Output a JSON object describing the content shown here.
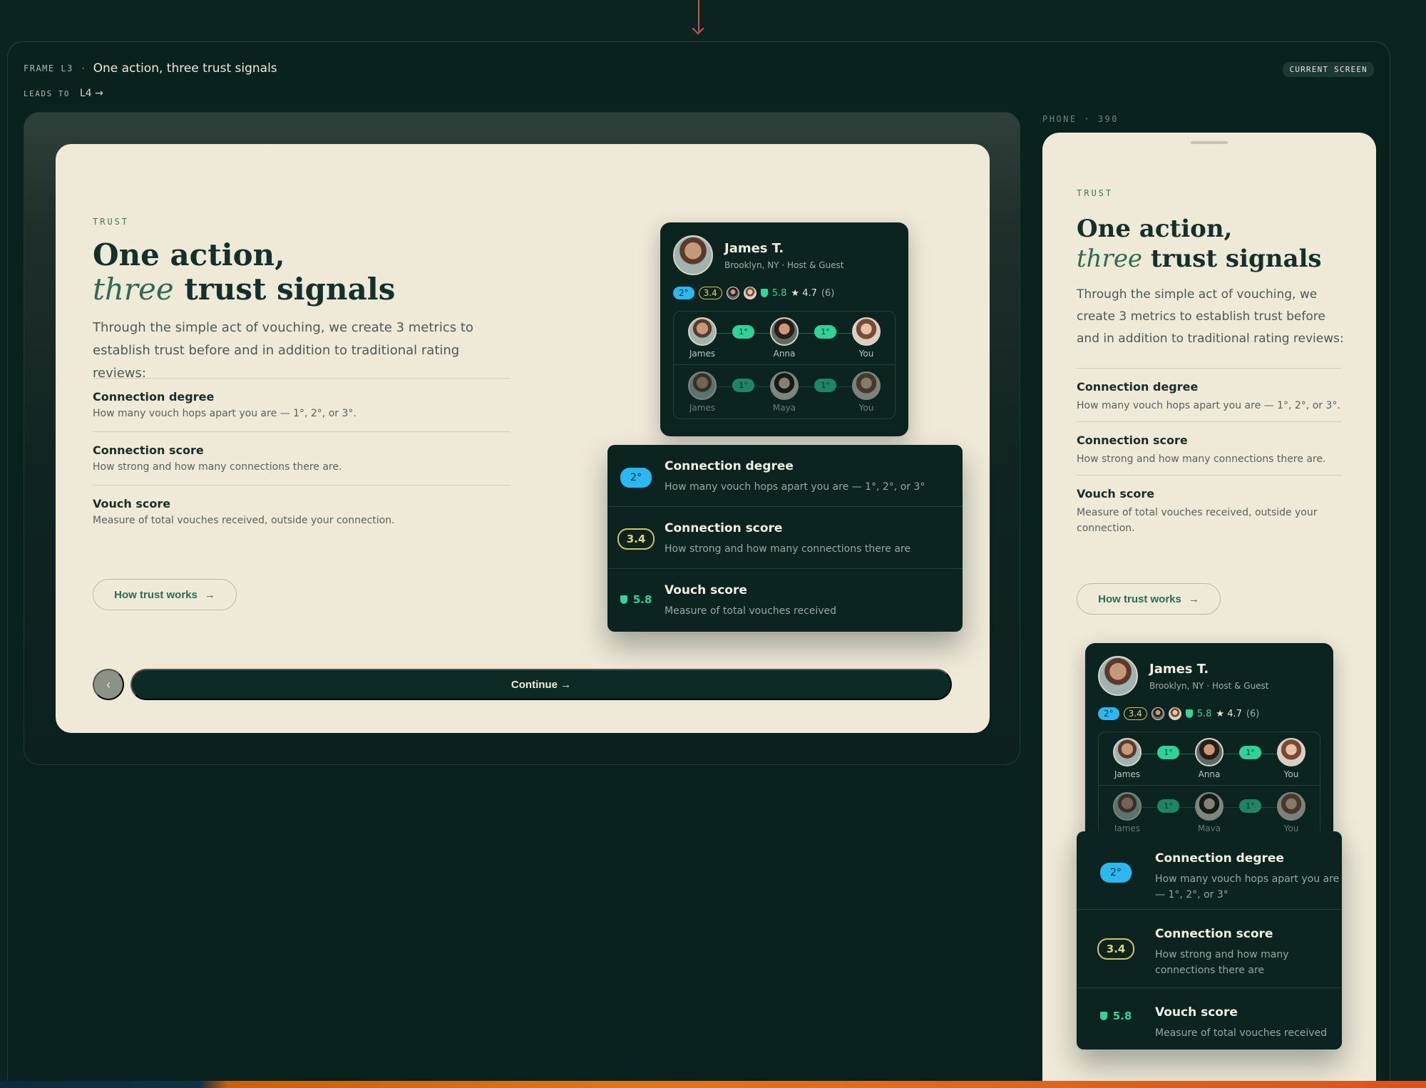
{
  "frame": {
    "tag": "FRAME L3",
    "separator": "·",
    "title": "One action, three trust signals",
    "leads_to_label": "LEADS TO",
    "leads_to_value": "L4 →",
    "badge": "CURRENT SCREEN"
  },
  "screen": {
    "eyebrow": "TRUST",
    "title_line1": "One action,",
    "title_em": "three",
    "title_rest": " trust signals",
    "intro": "Through the simple act of vouching, we create 3 metrics to establish trust before and in addition to traditional rating reviews:",
    "metrics": [
      {
        "title": "Connection degree",
        "desc": "How many vouch hops apart you are — 1°, 2°, or 3°."
      },
      {
        "title": "Connection score",
        "desc": "How strong and how many connections there are."
      },
      {
        "title": "Vouch score",
        "desc": "Measure of total vouches received, outside your connection."
      }
    ],
    "how_button": "How trust works",
    "how_arrow": "→",
    "prev_icon": "‹",
    "continue_button": "Continue →"
  },
  "profile": {
    "name": "James T.",
    "location": "Brooklyn, NY · Host & Guest",
    "degree": "2°",
    "score": "3.4",
    "vouch": "5.8",
    "rating": "★ 4.7",
    "rating_count": "(6)",
    "chain_rows": [
      {
        "a": "James",
        "hop1": "1°",
        "b": "Anna",
        "hop2": "1°",
        "c": "You"
      },
      {
        "a": "James",
        "hop1": "1°",
        "b": "Maya",
        "hop2": "1°",
        "c": "You"
      }
    ]
  },
  "panel": {
    "items": [
      {
        "badge": "2°",
        "title": "Connection degree",
        "desc": "How many vouch hops apart you are — 1°, 2°, or 3°"
      },
      {
        "badge": "3.4",
        "title": "Connection score",
        "desc": "How strong and how many connections there are"
      },
      {
        "badge": "5.8",
        "title": "Vouch score",
        "desc": "Measure of total vouches received"
      }
    ]
  },
  "phone": {
    "label": "PHONE · 390"
  },
  "icons": {
    "shield": "shield-icon",
    "arrow": "arrow-right-icon",
    "prev": "chevron-left-icon"
  },
  "colors": {
    "background": "#0b2420",
    "card": "#efe9d8",
    "primary": "#0d2b24",
    "accent_green": "#2e6b52",
    "degree_blue": "#2bb8f0",
    "score_yellow": "#d7c25e",
    "vouch_green": "#34d39a"
  }
}
